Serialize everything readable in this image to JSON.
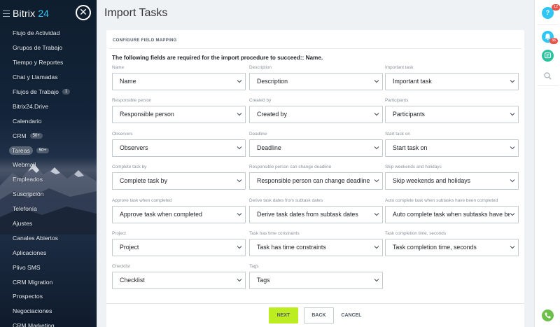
{
  "app": {
    "logo_text": "Bitrix",
    "logo_number": "24"
  },
  "sidebar": {
    "items": [
      {
        "label": "Flujo de Actividad"
      },
      {
        "label": "Grupos de Trabajo"
      },
      {
        "label": "Tiempo y Reportes"
      },
      {
        "label": "Chat y Llamadas"
      },
      {
        "label": "Flujos de Trabajo",
        "badge": "1"
      },
      {
        "label": "Bitrix24.Drive"
      },
      {
        "label": "Calendario"
      },
      {
        "label": "CRM",
        "badge": "50+"
      },
      {
        "label": "Tareas",
        "badge": "50+",
        "active": true
      },
      {
        "label": "Webmail"
      },
      {
        "label": "Empleados"
      },
      {
        "label": "Suscripción"
      },
      {
        "label": "Telefonía"
      },
      {
        "label": "Ajustes"
      },
      {
        "label": "Canales Abiertos"
      },
      {
        "label": "Aplicaciones"
      },
      {
        "label": "Plivo SMS"
      },
      {
        "label": "CRM Migration"
      },
      {
        "label": "Prospectos"
      },
      {
        "label": "Negociaciones"
      },
      {
        "label": "CRM Marketing"
      }
    ]
  },
  "page": {
    "title": "Import Tasks"
  },
  "mapping": {
    "section_title": "CONFIGURE FIELD MAPPING",
    "notice": "The following fields are required for the import procedure to succeed:: Name.",
    "fields": [
      {
        "label": "Name",
        "value": "Name"
      },
      {
        "label": "Description",
        "value": "Description"
      },
      {
        "label": "Important task",
        "value": "Important task"
      },
      {
        "label": "Responsible person",
        "value": "Responsible person"
      },
      {
        "label": "Created by",
        "value": "Created by"
      },
      {
        "label": "Participants",
        "value": "Participants"
      },
      {
        "label": "Observers",
        "value": "Observers"
      },
      {
        "label": "Deadline",
        "value": "Deadline"
      },
      {
        "label": "Start task on",
        "value": "Start task on"
      },
      {
        "label": "Complete task by",
        "value": "Complete task by"
      },
      {
        "label": "Responsible person can change deadline",
        "value": "Responsible person can change deadline"
      },
      {
        "label": "Skip weekends and holidays",
        "value": "Skip weekends and holidays"
      },
      {
        "label": "Approve task when completed",
        "value": "Approve task when completed"
      },
      {
        "label": "Derive task dates from subtask dates",
        "value": "Derive task dates from subtask dates"
      },
      {
        "label": "Auto complete task when subtasks have been completed",
        "value": "Auto complete task when subtasks have been completed"
      },
      {
        "label": "Project",
        "value": "Project"
      },
      {
        "label": "Task has time constraints",
        "value": "Task has time constraints"
      },
      {
        "label": "Task completion time, seconds",
        "value": "Task completion time, seconds"
      },
      {
        "label": "Checklist",
        "value": "Checklist"
      },
      {
        "label": "Tags",
        "value": "Tags"
      }
    ]
  },
  "footer": {
    "next_label": "NEXT",
    "back_label": "BACK",
    "cancel_label": "CANCEL"
  },
  "rightbar": {
    "help_badge": "12",
    "notifications_badge": "36",
    "icons": [
      "help-icon",
      "bell-icon",
      "chat-icon",
      "search-icon",
      "phone-icon"
    ]
  },
  "colors": {
    "accent": "#2fc6f6",
    "next_button": "#bbed21",
    "badge_red": "#e7544b",
    "sidebar_bg": "#13243a"
  }
}
